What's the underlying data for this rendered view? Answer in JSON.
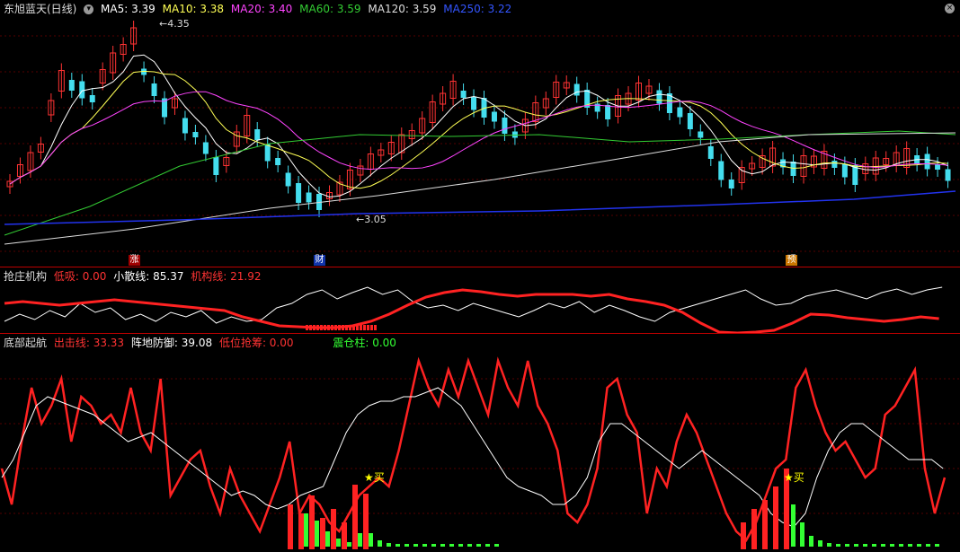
{
  "main_pane": {
    "stock_name": "东旭蓝天(日线)",
    "ma": [
      {
        "label": "MA5: 3.39",
        "color": "#ffffff"
      },
      {
        "label": "MA10: 3.38",
        "color": "#ffff55"
      },
      {
        "label": "MA20: 3.40",
        "color": "#ff44ff"
      },
      {
        "label": "MA60: 3.59",
        "color": "#33cc33"
      },
      {
        "label": "MA120: 3.59",
        "color": "#dddddd"
      },
      {
        "label": "MA250: 3.22",
        "color": "#3355ff"
      }
    ],
    "high_marker": "4.35",
    "low_marker": "3.05",
    "event_tags": [
      {
        "text": "涨",
        "bg": "#a00000"
      },
      {
        "text": "财",
        "bg": "#1133aa"
      },
      {
        "text": "预",
        "bg": "#cc7700"
      }
    ]
  },
  "pane2": {
    "title": "抢庄机构",
    "items": [
      {
        "label": "低吸: 0.00",
        "color": "#ff3333"
      },
      {
        "label": "小散线: 85.37",
        "color": "#ffffff"
      },
      {
        "label": "机构线: 21.92",
        "color": "#ff3333"
      }
    ]
  },
  "pane3": {
    "title": "底部起航",
    "items": [
      {
        "label": "出击线: 33.33",
        "color": "#ff3333"
      },
      {
        "label": "阵地防御: 39.08",
        "color": "#ffffff"
      },
      {
        "label": "低位抢筹: 0.00",
        "color": "#ff3333"
      },
      {
        "label": "震仓柱: 0.00",
        "color": "#33ff33"
      }
    ],
    "buy_label": "买"
  },
  "colors": {
    "up": "#ff3333",
    "down": "#44ddee",
    "grid": "#550000",
    "divider": "#aa0000"
  }
}
